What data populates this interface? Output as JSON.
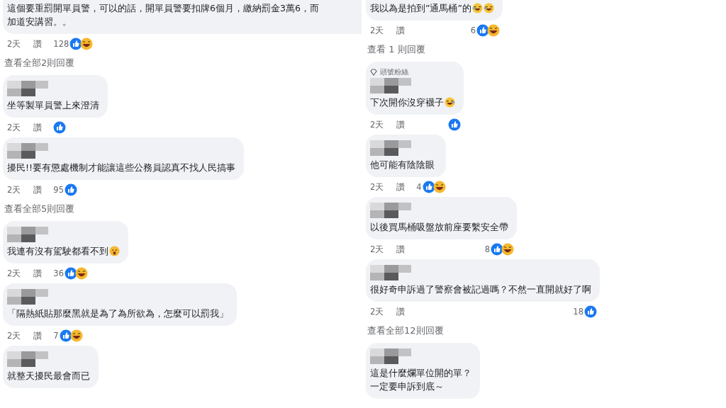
{
  "columns": [
    {
      "items": [
        {
          "kind": "comment",
          "lines": [
            "這個要重罰開單員警，可以的話，開單員警要扣牌6個月，繳納罰金3萬6，而",
            "加道安講習。。"
          ],
          "time": "2天",
          "action": "讚",
          "count": "128",
          "reactions": [
            {
              "kind": "like"
            },
            {
              "kind": "haha"
            }
          ]
        },
        {
          "kind": "replies",
          "label": "查看全部2則回覆"
        },
        {
          "kind": "comment",
          "name_hidden": true,
          "lines": [
            "坐等製單員警上來澄清"
          ],
          "time": "2天",
          "action": "讚",
          "reactions": [
            {
              "kind": "like"
            }
          ]
        },
        {
          "kind": "comment",
          "name_hidden": true,
          "lines": [
            "擾民!!要有懲處機制才能讓這些公務員認真不找人民搞事"
          ],
          "time": "2天",
          "action": "讚",
          "count": "95",
          "reactions": [
            {
              "kind": "like"
            }
          ]
        },
        {
          "kind": "replies",
          "label": "查看全部5則回覆"
        },
        {
          "kind": "comment",
          "name_hidden": true,
          "lines": [
            "我連有沒有駕駛都看不到"
          ],
          "emoji": [
            {
              "kind": "shocked"
            }
          ],
          "time": "2天",
          "action": "讚",
          "count": "36",
          "reactions": [
            {
              "kind": "like"
            },
            {
              "kind": "haha"
            }
          ]
        },
        {
          "kind": "comment",
          "name_hidden": true,
          "lines": [
            "「隔熱紙貼那麼黑就是為了為所欲為，怎麼可以罰我」"
          ],
          "time": "2天",
          "action": "讚",
          "count": "7",
          "reactions": [
            {
              "kind": "like"
            },
            {
              "kind": "haha"
            }
          ]
        },
        {
          "kind": "comment",
          "name_hidden": true,
          "lines": [
            "就整天擾民最會而已"
          ]
        }
      ]
    },
    {
      "items": [
        {
          "kind": "comment",
          "lines": [
            "我以為是拍到”通馬桶”的"
          ],
          "emoji": [
            {
              "kind": "rofl"
            },
            {
              "kind": "rofl"
            }
          ],
          "time": "2天",
          "action": "讚",
          "count": "6",
          "reactions": [
            {
              "kind": "like"
            },
            {
              "kind": "haha"
            }
          ],
          "reactions_at_end": true
        },
        {
          "kind": "replies",
          "label": "查看 1 則回覆"
        },
        {
          "kind": "comment",
          "badge": "頭號粉絲",
          "name_hidden": true,
          "lines": [
            "下次開你沒穿襪子"
          ],
          "emoji": [
            {
              "kind": "joy"
            }
          ],
          "time": "2天",
          "action": "讚",
          "reactions": [
            {
              "kind": "like"
            }
          ],
          "reactions_at_end": true
        },
        {
          "kind": "comment",
          "name_hidden": true,
          "lines": [
            "他可能有陰陰眼"
          ],
          "time": "2天",
          "action": "讚",
          "count": "4",
          "reactions": [
            {
              "kind": "like"
            },
            {
              "kind": "haha"
            }
          ]
        },
        {
          "kind": "comment",
          "name_hidden": true,
          "lines": [
            "以後買馬桶吸盤放前座要繫安全帶"
          ],
          "time": "2天",
          "action": "讚",
          "count": "8",
          "reactions": [
            {
              "kind": "like"
            },
            {
              "kind": "haha"
            }
          ],
          "reactions_at_end": true
        },
        {
          "kind": "comment",
          "name_hidden": true,
          "lines": [
            "很好奇申訴過了警察會被記過嗎？不然一直開就好了啊"
          ],
          "time": "2天",
          "action": "讚",
          "count": "18",
          "reactions": [
            {
              "kind": "like"
            }
          ],
          "reactions_at_end": true
        },
        {
          "kind": "replies",
          "label": "查看全部12則回覆"
        },
        {
          "kind": "comment",
          "name_hidden": true,
          "lines": [
            "這是什麼爛單位開的單？",
            "一定要申訴到底～"
          ]
        }
      ]
    }
  ]
}
